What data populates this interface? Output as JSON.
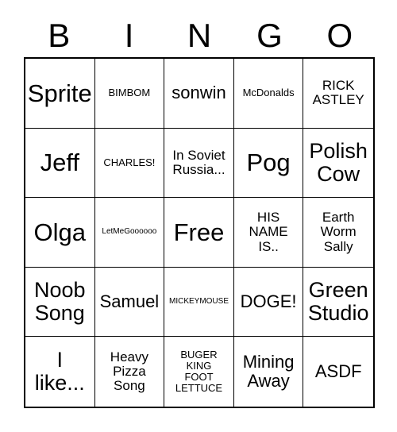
{
  "card": {
    "headers": [
      "B",
      "I",
      "N",
      "G",
      "O"
    ],
    "cells": [
      {
        "text": "Sprite",
        "size": "xl"
      },
      {
        "text": "BIMBOM",
        "size": "xs"
      },
      {
        "text": "sonwin",
        "size": "md"
      },
      {
        "text": "McDonalds",
        "size": "xs"
      },
      {
        "text": "RICK\nASTLEY",
        "size": "sm"
      },
      {
        "text": "Jeff",
        "size": "xl"
      },
      {
        "text": "CHARLES!",
        "size": "xs"
      },
      {
        "text": "In Soviet\nRussia...",
        "size": "sm"
      },
      {
        "text": "Pog",
        "size": "xl"
      },
      {
        "text": "Polish\nCow",
        "size": "lg"
      },
      {
        "text": "Olga",
        "size": "xl"
      },
      {
        "text": "LetMeGoooooo",
        "size": "xxs"
      },
      {
        "text": "Free",
        "size": "xl"
      },
      {
        "text": "HIS\nNAME\nIS..",
        "size": "sm"
      },
      {
        "text": "Earth\nWorm\nSally",
        "size": "sm"
      },
      {
        "text": "Noob\nSong",
        "size": "lg"
      },
      {
        "text": "Samuel",
        "size": "md"
      },
      {
        "text": "MICKEYMOUSE",
        "size": "xxs"
      },
      {
        "text": "DOGE!",
        "size": "md"
      },
      {
        "text": "Green\nStudio",
        "size": "lg"
      },
      {
        "text": "I\nlike...",
        "size": "lg"
      },
      {
        "text": "Heavy\nPizza\nSong",
        "size": "sm"
      },
      {
        "text": "BUGER\nKING\nFOOT\nLETTUCE",
        "size": "xs"
      },
      {
        "text": "Mining\nAway",
        "size": "md"
      },
      {
        "text": "ASDF",
        "size": "md"
      }
    ]
  },
  "colors": {
    "background": "#ffffff",
    "text": "#000000",
    "grid_line": "#000000"
  }
}
